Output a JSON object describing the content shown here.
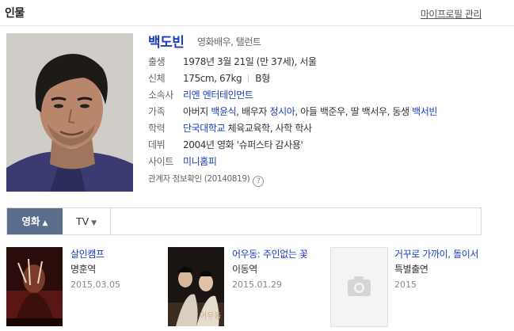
{
  "header": {
    "title": "인물",
    "my_profile_link": "마이프로필 관리"
  },
  "person": {
    "name": "백도빈",
    "job": "영화배우, 탤런트",
    "birth_label": "출생",
    "birth_value": "1978년 3월 21일 (만 37세), 서울",
    "body_label": "신체",
    "body_size": "175cm, 67kg",
    "blood": "B형",
    "agency_label": "소속사",
    "agency_value": "리엔 엔터테인먼트",
    "family_label": "가족",
    "family": {
      "p1": "아버지 ",
      "father": "백윤식",
      "p2": ", 배우자 ",
      "spouse": "정시아",
      "p3": ", 아들 백준우, 딸 백서우, 동생 ",
      "sibling": "백서빈"
    },
    "edu_label": "학력",
    "edu_school": "단국대학교",
    "edu_rest": " 체육교육학, 사학 학사",
    "debut_label": "데뷔",
    "debut_value": "2004년 영화 '슈퍼스타 감사용'",
    "site_label": "사이트",
    "site_value": "미니홈피",
    "verify_text": "관계자 정보확인 (20140819)",
    "verify_icon": "?"
  },
  "tabs": {
    "movie": "영화",
    "tv": "TV",
    "movie_chevron": "▲",
    "tv_chevron": "▼"
  },
  "films": [
    {
      "title": "살인캠프",
      "role": "명훈역",
      "date": "2015.03.05"
    },
    {
      "title": "어우동: 주인없는 꽃",
      "role": "이동역",
      "date": "2015.01.29"
    },
    {
      "title": "거꾸로 가까이, 돌이서",
      "role": "특별출연",
      "date": "2015"
    }
  ],
  "colors": {
    "link": "#1a3dc1",
    "tab_active_bg": "#5b6d8c"
  }
}
